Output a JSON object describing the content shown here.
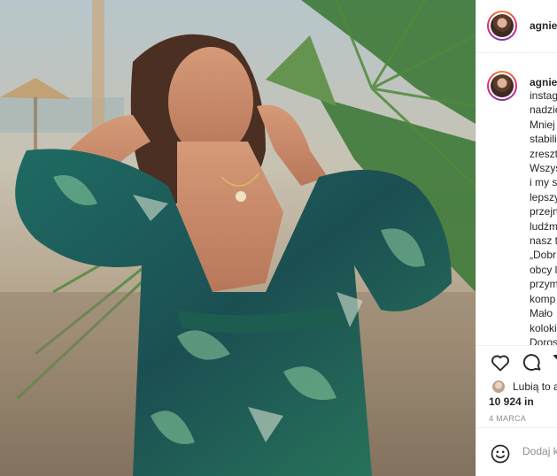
{
  "post": {
    "username": "agnies",
    "caption_lines": [
      "instag",
      "nadzie",
      "Mniej",
      "stabili",
      "zreszt",
      "Wszys",
      "i my s",
      "lepszy",
      "przejn",
      "ludźm",
      "nasz t",
      "„Dobr",
      "obcy l",
      "przym",
      "komp",
      "Mało",
      "koloki",
      "Doros"
    ],
    "likes_prefix": "Lubią to a",
    "likes_count": "10 924 in",
    "date": "4 MARCA",
    "comment_placeholder": "Dodaj k"
  },
  "icons": {
    "like": "heart-icon",
    "comment": "comment-icon",
    "share": "share-icon",
    "emoji": "emoji-icon"
  },
  "colors": {
    "text": "#262626",
    "muted": "#8e8e8e",
    "divider": "#efefef",
    "story_ring": "#dd2a7b"
  }
}
